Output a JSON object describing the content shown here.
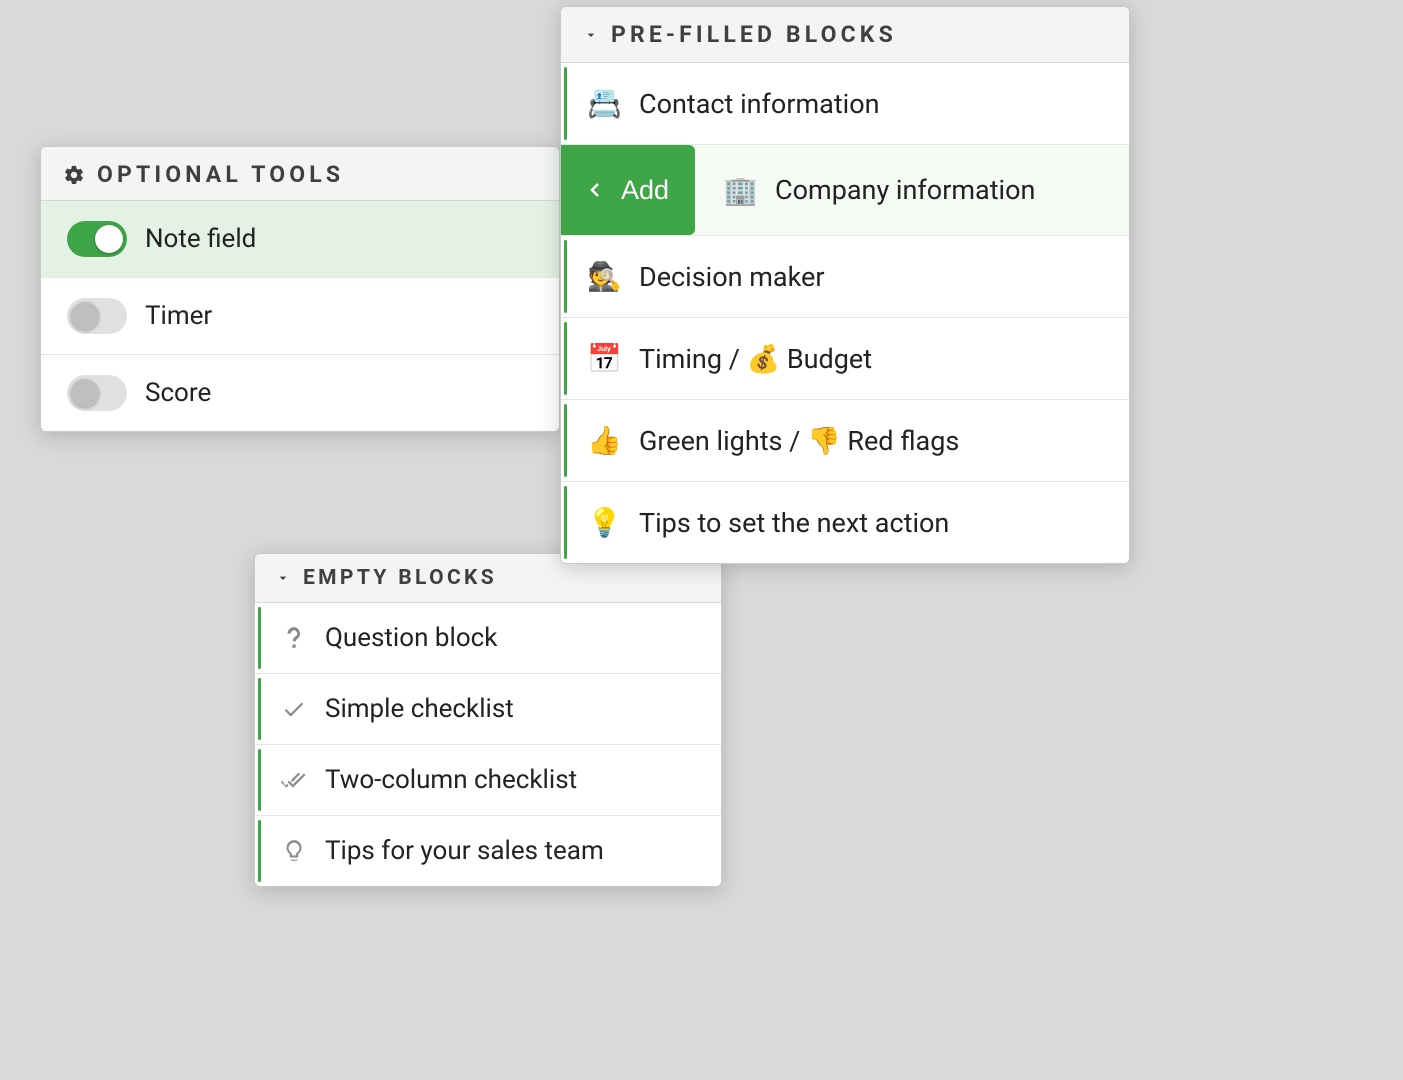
{
  "optional_tools": {
    "title": "OPTIONAL TOOLS",
    "items": [
      {
        "label": "Note field",
        "enabled": true
      },
      {
        "label": "Timer",
        "enabled": false
      },
      {
        "label": "Score",
        "enabled": false
      }
    ]
  },
  "empty_blocks": {
    "title": "EMPTY BLOCKS",
    "items": [
      {
        "icon": "question-icon",
        "label": "Question block"
      },
      {
        "icon": "check-icon",
        "label": "Simple checklist"
      },
      {
        "icon": "double-check-icon",
        "label": "Two-column checklist"
      },
      {
        "icon": "bulb-icon",
        "label": "Tips for your sales team"
      }
    ]
  },
  "pre_filled_blocks": {
    "title": "PRE-FILLED BLOCKS",
    "add_button_label": "Add",
    "items": [
      {
        "emoji": "📇",
        "label": "Contact information"
      },
      {
        "emoji": "🏢",
        "label": "Company information",
        "hovered": true
      },
      {
        "emoji": "🕵️",
        "label": "Decision maker"
      },
      {
        "emoji": "📅",
        "label": "Timing / 💰 Budget"
      },
      {
        "emoji": "👍",
        "label": "Green lights / 👎 Red flags"
      },
      {
        "emoji": "💡",
        "label": "Tips to set the next action"
      }
    ]
  }
}
